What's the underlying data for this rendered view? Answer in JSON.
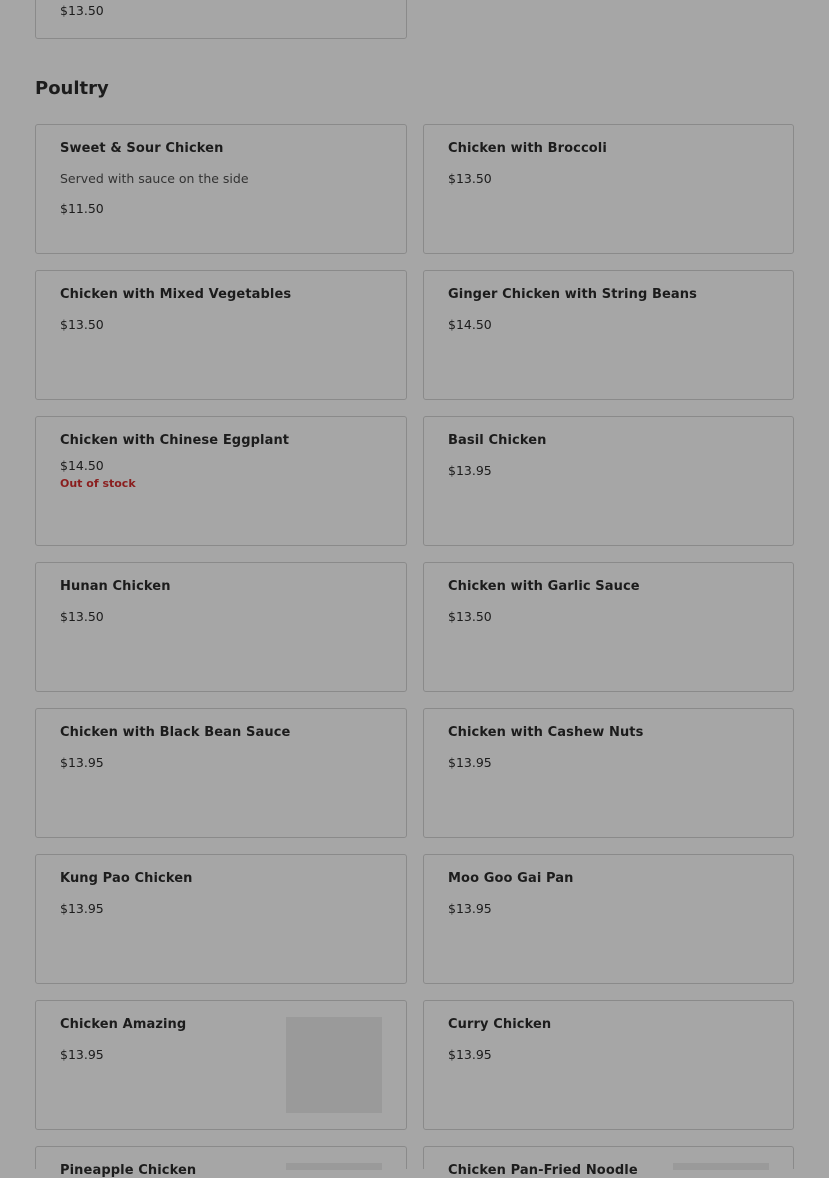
{
  "prev_card": {
    "price": "$13.50"
  },
  "section": {
    "title": "Poultry"
  },
  "items": [
    {
      "name": "Sweet & Sour Chicken",
      "description": "Served with sauce on the side",
      "price": "$11.50"
    },
    {
      "name": "Chicken with Broccoli",
      "price": "$13.50"
    },
    {
      "name": "Chicken with Mixed Vegetables",
      "price": "$13.50"
    },
    {
      "name": "Ginger Chicken with String Beans",
      "price": "$14.50"
    },
    {
      "name": "Chicken with Chinese Eggplant",
      "price": "$14.50",
      "status": "Out of stock"
    },
    {
      "name": "Basil Chicken",
      "price": "$13.95"
    },
    {
      "name": "Hunan Chicken",
      "price": "$13.50"
    },
    {
      "name": "Chicken with Garlic Sauce",
      "price": "$13.50"
    },
    {
      "name": "Chicken with Black Bean Sauce",
      "price": "$13.95"
    },
    {
      "name": "Chicken with Cashew Nuts",
      "price": "$13.95"
    },
    {
      "name": "Kung Pao Chicken",
      "price": "$13.95"
    },
    {
      "name": "Moo Goo Gai Pan",
      "price": "$13.95"
    },
    {
      "name": "Chicken Amazing",
      "price": "$13.95"
    },
    {
      "name": "Curry Chicken",
      "price": "$13.95"
    },
    {
      "name": "Pineapple Chicken"
    },
    {
      "name": "Chicken Pan-Fried Noodle"
    }
  ],
  "colors": {
    "overlay": "#a6a6a6",
    "out_of_stock": "#8a1d1d"
  }
}
